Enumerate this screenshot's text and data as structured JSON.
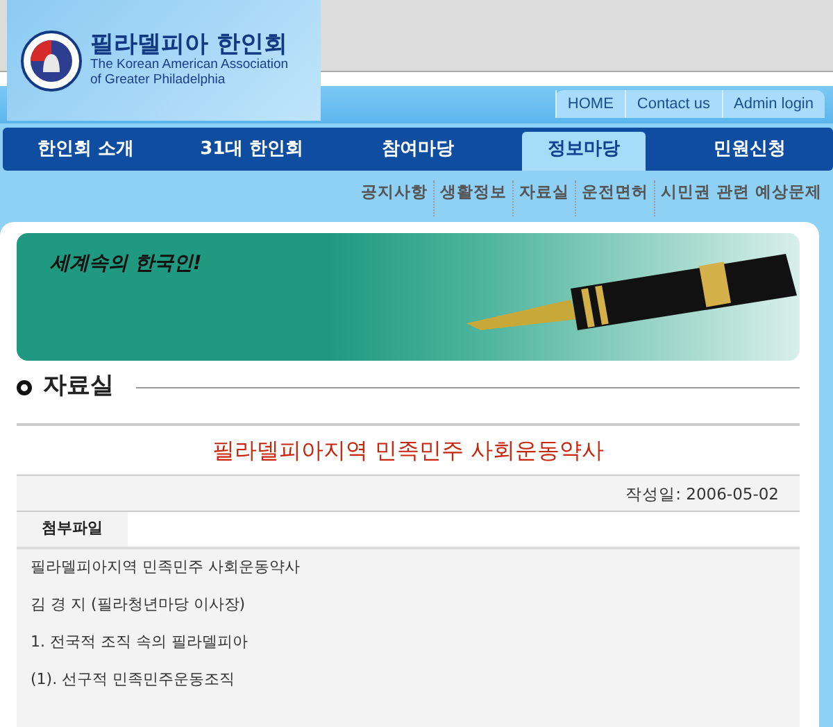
{
  "header": {
    "logo_title": "필라델피아 한인회",
    "logo_subtitle_lines": [
      "The Korean American Association",
      "of Greater Philadelphia"
    ],
    "top_links": [
      "HOME",
      "Contact us",
      "Admin login"
    ]
  },
  "main_nav": [
    {
      "label": "한인회 소개",
      "selected": false
    },
    {
      "label": "31대 한인회",
      "selected": false
    },
    {
      "label": "참여마당",
      "selected": false
    },
    {
      "label": "정보마당",
      "selected": true
    },
    {
      "label": "민원신청",
      "selected": false
    }
  ],
  "sub_nav": [
    "공지사항",
    "생활정보",
    "자료실",
    "운전면허",
    "시민권 관련 예상문제"
  ],
  "banner": {
    "slogan": "세계속의 한국인!"
  },
  "section_title": "자료실",
  "article": {
    "title": "필라델피아지역 민족민주 사회운동약사",
    "date": "작성일: 2006-05-02",
    "attachment_tab": "첨부파일",
    "paragraphs": [
      "필라델피아지역 민족민주 사회운동약사",
      "김 경 지 (필라청년마당 이사장)",
      "1. 전국적 조직 속의 필라델피아",
      "(1). 선구적 민족민주운동조직"
    ]
  }
}
